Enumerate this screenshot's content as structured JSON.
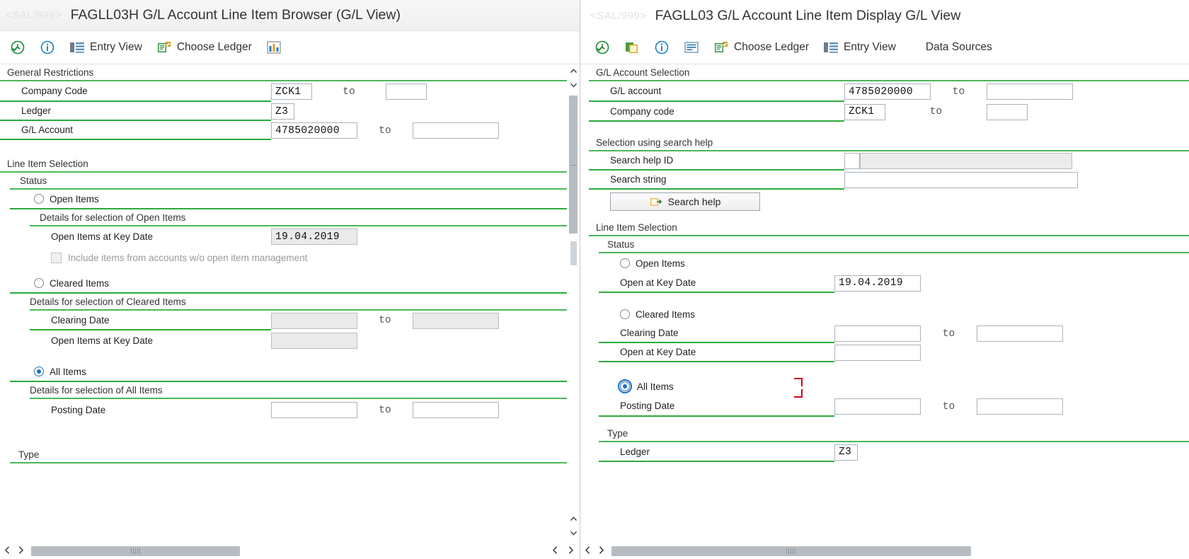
{
  "left": {
    "title_ghost": "<SAL/999>",
    "title": "FAGLL03H G/L Account Line Item Browser (G/L View)",
    "toolbar": [
      {
        "icon": "clock-check-icon",
        "label": ""
      },
      {
        "icon": "info-icon",
        "label": ""
      },
      {
        "icon": "entry-view-icon",
        "label": "Entry View"
      },
      {
        "icon": "choose-ledger-icon",
        "label": "Choose Ledger"
      },
      {
        "icon": "chart-columns-icon",
        "label": ""
      }
    ],
    "sections": {
      "general_restrictions": "General Restrictions",
      "line_item_selection": "Line Item Selection",
      "status": "Status",
      "type": "Type"
    },
    "fields": {
      "company_code_label": "Company Code",
      "company_code_value": "ZCK1",
      "ledger_label": "Ledger",
      "ledger_value": "Z3",
      "gl_account_label": "G/L Account",
      "gl_account_value": "4785020000",
      "to_label": "to",
      "to_value": ""
    },
    "status": {
      "open_items_label": "Open Items",
      "open_items_selected": false,
      "open_details_label": "Details for selection of Open Items",
      "open_items_key_date_label": "Open Items at Key Date",
      "open_items_key_date_value": "19.04.2019",
      "include_items_label": "Include items from accounts w/o open item management",
      "include_items_checked": false,
      "cleared_items_label": "Cleared Items",
      "cleared_items_selected": false,
      "cleared_details_label": "Details for selection of Cleared Items",
      "clearing_date_label": "Clearing Date",
      "clearing_date_value": "",
      "cleared_open_key_date_label": "Open Items at Key Date",
      "cleared_open_key_date_value": "",
      "all_items_label": "All Items",
      "all_items_selected": true,
      "all_details_label": "Details for selection of All Items",
      "posting_date_label": "Posting Date",
      "posting_date_value": ""
    },
    "hscroll_thumb_pct": 36
  },
  "right": {
    "title_ghost": "<SAL/999>",
    "title": "FAGLL03 G/L Account Line Item Display G/L View",
    "toolbar": [
      {
        "icon": "clock-check-icon",
        "label": ""
      },
      {
        "icon": "copy-variant-icon",
        "label": ""
      },
      {
        "icon": "info-icon",
        "label": ""
      },
      {
        "icon": "list-icon",
        "label": ""
      },
      {
        "icon": "choose-ledger-icon",
        "label": "Choose Ledger"
      },
      {
        "icon": "entry-view-icon",
        "label": "Entry View"
      },
      {
        "icon": "data-sources-icon",
        "label": "Data Sources"
      }
    ],
    "sections": {
      "gl_account_selection": "G/L Account Selection",
      "selection_using_search_help": "Selection using search help",
      "line_item_selection": "Line Item Selection",
      "status": "Status",
      "type": "Type"
    },
    "fields": {
      "gl_account_label": "G/L account",
      "gl_account_value": "4785020000",
      "company_code_label": "Company code",
      "company_code_value": "ZCK1",
      "to_label": "to",
      "search_help_id_label": "Search help ID",
      "search_help_id_value": "",
      "search_string_label": "Search string",
      "search_string_value": "",
      "search_help_button": "Search help",
      "ledger_label": "Ledger",
      "ledger_value": "Z3"
    },
    "status": {
      "open_items_label": "Open Items",
      "open_items_selected": false,
      "open_at_key_date_label": "Open at Key Date",
      "open_at_key_date_value": "19.04.2019",
      "cleared_items_label": "Cleared Items",
      "cleared_items_selected": false,
      "clearing_date_label": "Clearing Date",
      "clearing_date_value": "",
      "cleared_open_at_key_date_label": "Open at Key Date",
      "cleared_open_at_key_date_value": "",
      "all_items_label": "All Items",
      "all_items_selected": true,
      "posting_date_label": "Posting Date",
      "posting_date_value": ""
    },
    "hscroll_thumb_pct": 62
  },
  "colors": {
    "green_rule": "#2bab3a",
    "radio_accent": "#1a6fc4",
    "red_marker": "#d0021b",
    "scrollbar": "#b6bcc2"
  }
}
